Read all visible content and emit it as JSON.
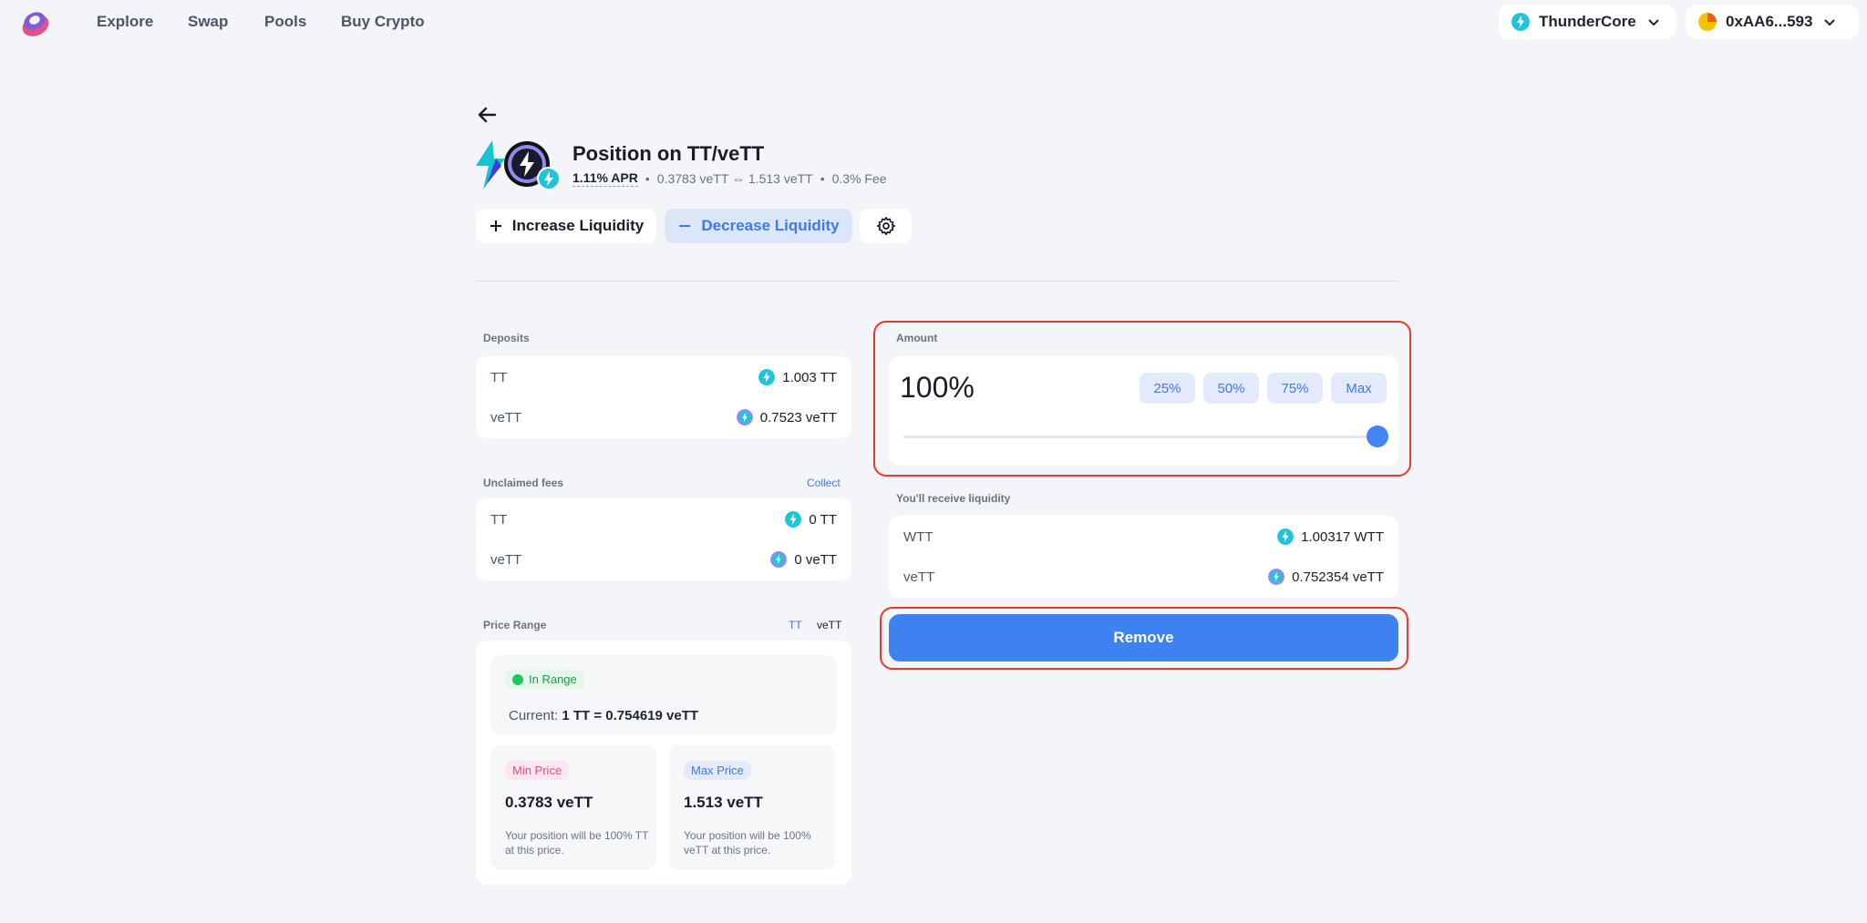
{
  "nav": {
    "links": [
      "Explore",
      "Swap",
      "Pools",
      "Buy Crypto"
    ],
    "network": "ThunderCore",
    "wallet": "0xAA6...593"
  },
  "header": {
    "title": "Position on TT/veTT",
    "apr": "1.11% APR",
    "price_range": "0.3783 veTT ⇔ 1.513 veTT",
    "fee": "0.3% Fee",
    "sep": "•"
  },
  "actions": {
    "increase": "Increase Liquidity",
    "decrease": "Decrease Liquidity"
  },
  "deposits": {
    "label": "Deposits",
    "rows": [
      {
        "token": "TT",
        "value": "1.003 TT"
      },
      {
        "token": "veTT",
        "value": "0.7523 veTT"
      }
    ]
  },
  "unclaimed": {
    "label": "Unclaimed fees",
    "collect": "Collect",
    "rows": [
      {
        "token": "TT",
        "value": "0 TT"
      },
      {
        "token": "veTT",
        "value": "0 veTT"
      }
    ]
  },
  "price_range": {
    "label": "Price Range",
    "toggle": [
      "TT",
      "veTT"
    ],
    "status": "In Range",
    "current_label": "Current:",
    "current_value": "1 TT = 0.754619 veTT",
    "min": {
      "badge": "Min Price",
      "value": "0.3783 veTT",
      "desc": "Your position will be 100% TT at this price."
    },
    "max": {
      "badge": "Max Price",
      "value": "1.513 veTT",
      "desc": "Your position will be 100% veTT at this price."
    }
  },
  "amount": {
    "label": "Amount",
    "value": "100%",
    "percent": 100,
    "presets": [
      "25%",
      "50%",
      "75%",
      "Max"
    ]
  },
  "receive": {
    "label": "You'll receive liquidity",
    "rows": [
      {
        "token": "WTT",
        "value": "1.00317 WTT"
      },
      {
        "token": "veTT",
        "value": "0.752354 veTT"
      }
    ]
  },
  "remove_label": "Remove",
  "colors": {
    "accent": "#3d82f0",
    "highlight": "#e53b2f",
    "in_range": "#22c55e"
  }
}
